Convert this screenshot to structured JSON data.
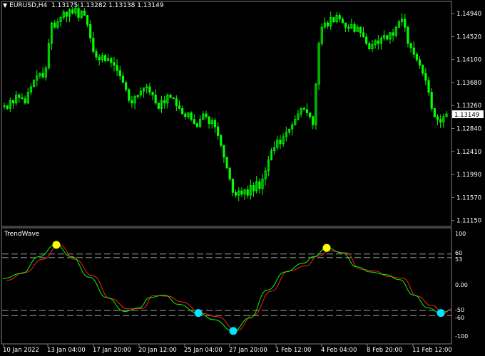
{
  "header": {
    "arrow_icon": "triangle-down-icon",
    "symbol": "EURUSD,H4",
    "ohlc": "1.13175 1.13282 1.13138 1.13149"
  },
  "colors": {
    "background": "#000000",
    "candle": "#00ff00",
    "grid": "#808080",
    "green_line": "#00ff00",
    "red_line": "#ff2020",
    "signal_top": "#ffff00",
    "signal_bottom": "#00e5ff",
    "level_line": "#a0a0a0"
  },
  "price_axis": {
    "labels": [
      "1.14940",
      "1.14520",
      "1.14100",
      "1.13680",
      "1.13260",
      "1.12840",
      "1.12410",
      "1.11990",
      "1.11570",
      "1.11150"
    ],
    "current_price": "1.13149"
  },
  "indicator": {
    "name": "TrendWave",
    "axis_labels": [
      "100",
      "60",
      "53",
      "0.00",
      "-50",
      "-60",
      "-100"
    ],
    "levels": [
      60,
      53,
      -50,
      -60
    ],
    "signals": [
      {
        "type": "top",
        "date": "13 Jan",
        "value": 78
      },
      {
        "type": "bottom",
        "date": "25 Jan",
        "value": -55
      },
      {
        "type": "bottom",
        "date": "27 Jan",
        "value": -90
      },
      {
        "type": "top",
        "date": "4 Feb",
        "value": 72
      },
      {
        "type": "bottom",
        "date": "11 Feb",
        "value": -55
      }
    ]
  },
  "time_axis": {
    "labels": [
      "10 Jan 2022",
      "13 Jan 04:00",
      "17 Jan 20:00",
      "20 Jan 12:00",
      "25 Jan 04:00",
      "27 Jan 20:00",
      "1 Feb 12:00",
      "4 Feb 04:00",
      "8 Feb 20:00",
      "11 Feb 12:00"
    ]
  },
  "chart_data": {
    "type": "candlestick",
    "symbol": "EURUSD",
    "timeframe": "H4",
    "ylim": [
      1.1105,
      1.1515
    ],
    "closes": [
      1.1325,
      1.132,
      1.1335,
      1.133,
      1.1345,
      1.134,
      1.1338,
      1.133,
      1.135,
      1.136,
      1.1372,
      1.138,
      1.1385,
      1.1378,
      1.1395,
      1.144,
      1.1478,
      1.147,
      1.148,
      1.1488,
      1.1498,
      1.149,
      1.1502,
      1.1496,
      1.1505,
      1.1488,
      1.15,
      1.1492,
      1.1475,
      1.145,
      1.1425,
      1.1415,
      1.141,
      1.1418,
      1.1408,
      1.1412,
      1.1405,
      1.14,
      1.139,
      1.138,
      1.1368,
      1.1355,
      1.1335,
      1.133,
      1.1342,
      1.1345,
      1.1352,
      1.1358,
      1.136,
      1.135,
      1.1345,
      1.133,
      1.132,
      1.1335,
      1.133,
      1.1345,
      1.134,
      1.1338,
      1.1325,
      1.132,
      1.131,
      1.1305,
      1.1312,
      1.13,
      1.1292,
      1.1286,
      1.13,
      1.131,
      1.1305,
      1.1292,
      1.1298,
      1.1286,
      1.127,
      1.1252,
      1.123,
      1.121,
      1.119,
      1.1165,
      1.116,
      1.1168,
      1.1162,
      1.117,
      1.116,
      1.1178,
      1.1168,
      1.1185,
      1.1172,
      1.119,
      1.1205,
      1.1225,
      1.1242,
      1.1248,
      1.1262,
      1.1255,
      1.1268,
      1.1276,
      1.1282,
      1.129,
      1.13,
      1.131,
      1.132,
      1.1318,
      1.1312,
      1.1305,
      1.129,
      1.1365,
      1.144,
      1.147,
      1.1478,
      1.1472,
      1.1488,
      1.148,
      1.1492,
      1.1485,
      1.1478,
      1.147,
      1.1468,
      1.1475,
      1.1462,
      1.147,
      1.146,
      1.1452,
      1.144,
      1.143,
      1.1438,
      1.1445,
      1.144,
      1.145,
      1.1455,
      1.1448,
      1.146,
      1.1455,
      1.147,
      1.148,
      1.1485,
      1.147,
      1.144,
      1.1432,
      1.142,
      1.141,
      1.14,
      1.1385,
      1.1372,
      1.135,
      1.132,
      1.1305,
      1.13,
      1.1295,
      1.1305,
      1.131
    ]
  }
}
